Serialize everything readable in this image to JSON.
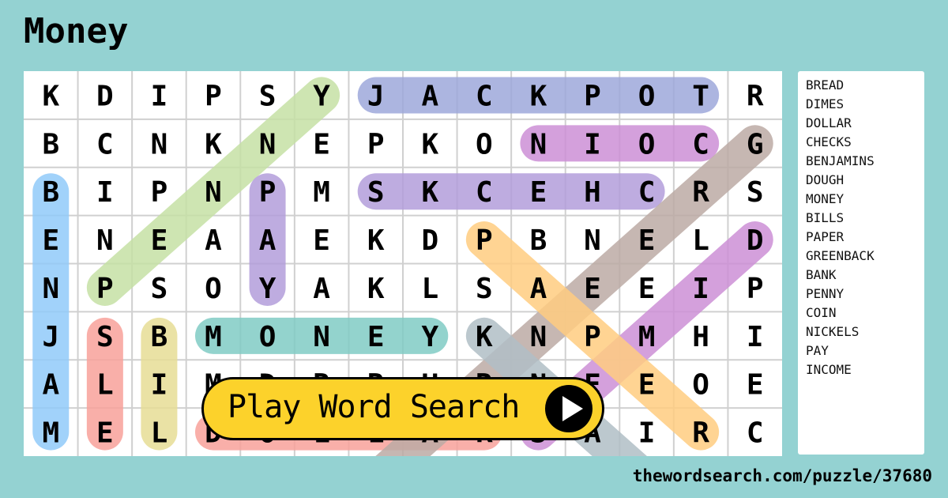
{
  "title": "Money",
  "grid": {
    "rows": [
      [
        "K",
        "D",
        "I",
        "P",
        "S",
        "Y",
        "J",
        "A",
        "C",
        "K",
        "P",
        "O",
        "T",
        "R"
      ],
      [
        "B",
        "C",
        "N",
        "K",
        "N",
        "E",
        "P",
        "K",
        "O",
        "N",
        "I",
        "O",
        "C",
        "G"
      ],
      [
        "B",
        "I",
        "P",
        "N",
        "P",
        "M",
        "S",
        "K",
        "C",
        "E",
        "H",
        "C",
        "R",
        "S"
      ],
      [
        "E",
        "N",
        "E",
        "A",
        "A",
        "E",
        "K",
        "D",
        "P",
        "B",
        "N",
        "E",
        "L",
        "D"
      ],
      [
        "N",
        "P",
        "S",
        "O",
        "Y",
        "A",
        "K",
        "L",
        "S",
        "A",
        "E",
        "E",
        "I",
        "P"
      ],
      [
        "J",
        "S",
        "B",
        "M",
        "O",
        "N",
        "E",
        "Y",
        "K",
        "N",
        "P",
        "M",
        "H",
        "I"
      ],
      [
        "A",
        "L",
        "I",
        "M",
        "D",
        "R",
        "R",
        "U",
        "R",
        "N",
        "E",
        "E",
        "O",
        "E"
      ],
      [
        "M",
        "E",
        "L",
        "D",
        "O",
        "L",
        "L",
        "A",
        "R",
        "S",
        "A",
        "I",
        "R",
        "C"
      ]
    ],
    "found": [
      {
        "word": "JACKPOT",
        "from": [
          0,
          6
        ],
        "to": [
          0,
          12
        ],
        "color": "#9ea8db"
      },
      {
        "word": "COIN",
        "from": [
          1,
          12
        ],
        "to": [
          1,
          9
        ],
        "color": "#cc8fd6"
      },
      {
        "word": "CHECKS",
        "from": [
          2,
          11
        ],
        "to": [
          2,
          6
        ],
        "color": "#b39ddb"
      },
      {
        "word": "PENNY",
        "from": [
          4,
          1
        ],
        "to": [
          0,
          5
        ],
        "color": "#c5e1a5"
      },
      {
        "word": "PAY",
        "from": [
          2,
          4
        ],
        "to": [
          4,
          4
        ],
        "color": "#b39ddb"
      },
      {
        "word": "BENJAM",
        "from": [
          2,
          0
        ],
        "to": [
          7,
          0
        ],
        "color": "#90caf9"
      },
      {
        "word": "SLE",
        "from": [
          5,
          1
        ],
        "to": [
          7,
          1
        ],
        "color": "#f8a19a"
      },
      {
        "word": "BIL",
        "from": [
          5,
          2
        ],
        "to": [
          7,
          2
        ],
        "color": "#e6dd95"
      },
      {
        "word": "MONEY",
        "from": [
          5,
          3
        ],
        "to": [
          5,
          7
        ],
        "color": "#80cbc4"
      },
      {
        "word": "DOLLAR",
        "from": [
          7,
          3
        ],
        "to": [
          7,
          8
        ],
        "color": "#f8a19a"
      },
      {
        "word": "GREENBACK",
        "from": [
          1,
          13
        ],
        "to": [
          8,
          6
        ],
        "color": "#bcaaa4"
      },
      {
        "word": "DIMES",
        "from": [
          3,
          13
        ],
        "to": [
          7,
          9
        ],
        "color": "#cc8fd6"
      },
      {
        "word": "PAPER",
        "from": [
          3,
          8
        ],
        "to": [
          7,
          12
        ],
        "color": "#ffcc80"
      },
      {
        "word": "BANK",
        "from": [
          5,
          8
        ],
        "to": [
          8,
          11
        ],
        "color": "#b0bec5"
      }
    ]
  },
  "words": [
    "BREAD",
    "DIMES",
    "DOLLAR",
    "CHECKS",
    "BENJAMINS",
    "DOUGH",
    "MONEY",
    "BILLS",
    "PAPER",
    "GREENBACK",
    "BANK",
    "PENNY",
    "COIN",
    "NICKELS",
    "PAY",
    "INCOME"
  ],
  "play_button": {
    "label": "Play Word Search",
    "icon": "play-icon"
  },
  "url": "thewordsearch.com/puzzle/37680"
}
